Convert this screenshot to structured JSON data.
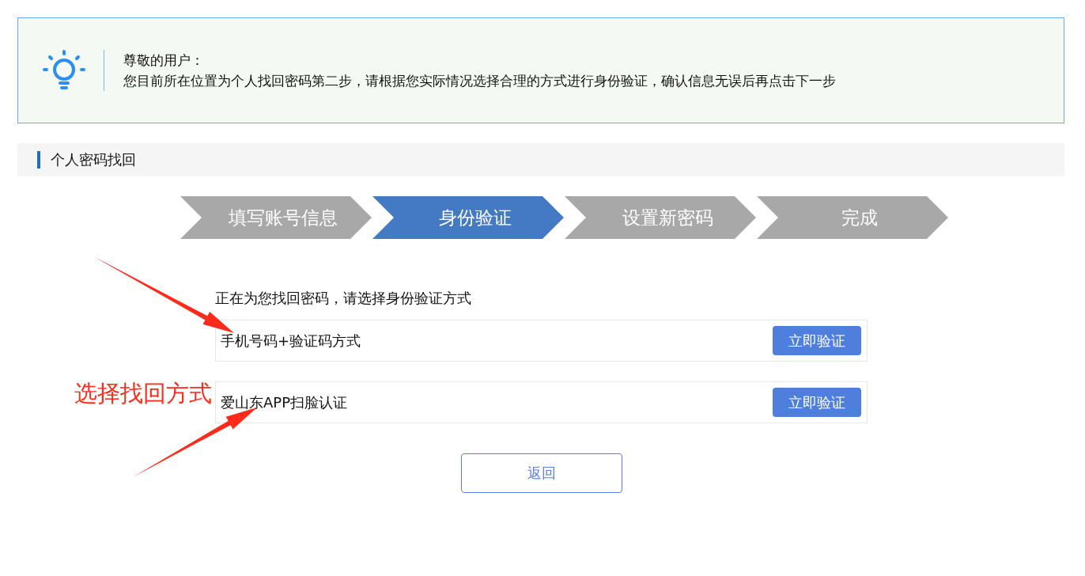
{
  "notice": {
    "greeting": "尊敬的用户：",
    "message": "您目前所在位置为个人找回密码第二步，请根据您实际情况选择合理的方式进行身份验证，确认信息无误后再点击下一步"
  },
  "section": {
    "title": "个人密码找回"
  },
  "steps": [
    {
      "label": "填写账号信息",
      "selected": false
    },
    {
      "label": "身份验证",
      "selected": true
    },
    {
      "label": "设置新密码",
      "selected": false
    },
    {
      "label": "完成",
      "selected": false
    }
  ],
  "prompt": "正在为您找回密码，请选择身份验证方式",
  "options": [
    {
      "label": "手机号码+验证码方式",
      "button": "立即验证"
    },
    {
      "label": "爱山东APP扫脸认证",
      "button": "立即验证"
    }
  ],
  "back_button": "返回",
  "annotation": {
    "label": "选择找回方式"
  }
}
